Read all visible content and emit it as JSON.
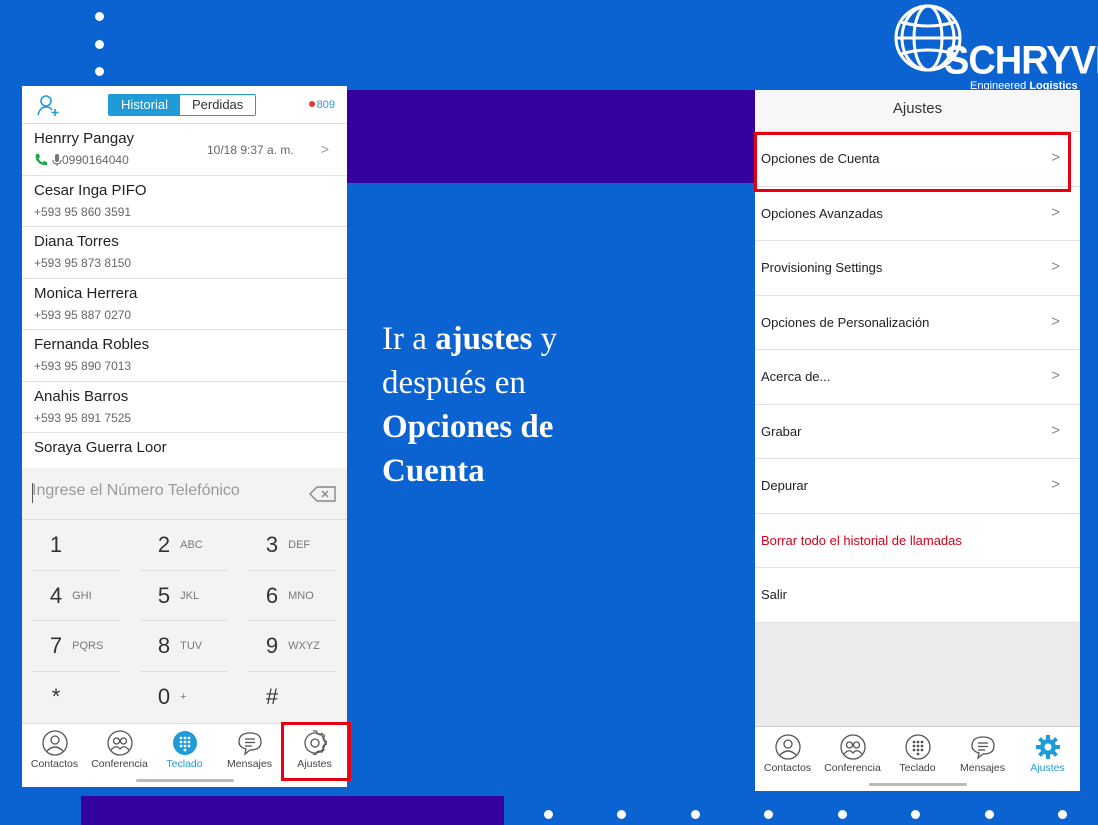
{
  "logo": {
    "brand": "SCHRYVER",
    "tagline_prefix": "Engineered ",
    "tagline_bold": "Logistics"
  },
  "instruction": {
    "part1": "Ir a ",
    "bold1": "ajustes",
    "part2": " y después en ",
    "bold2": "Opciones de Cuenta"
  },
  "left_phone": {
    "segment": {
      "active": "Historial",
      "inactive": "Perdidas"
    },
    "extension": "809",
    "calls": [
      {
        "name": "Henrry Pangay",
        "number": "0990164040",
        "time": "10/18 9:37 a. m."
      },
      {
        "name": "Cesar Inga PIFO",
        "number": "+593 95 860 3591"
      },
      {
        "name": "Diana Torres",
        "number": "+593 95 873 8150"
      },
      {
        "name": "Monica Herrera",
        "number": "+593 95 887 0270"
      },
      {
        "name": "Fernanda Robles",
        "number": "+593 95 890 7013"
      },
      {
        "name": "Anahis Barros",
        "number": "+593 95 891 7525"
      },
      {
        "name": "Soraya Guerra Loor"
      }
    ],
    "dial_placeholder": "Ingrese el Número Telefónico",
    "keys": [
      {
        "digit": "1",
        "letters": ""
      },
      {
        "digit": "2",
        "letters": "ABC"
      },
      {
        "digit": "3",
        "letters": "DEF"
      },
      {
        "digit": "4",
        "letters": "GHI"
      },
      {
        "digit": "5",
        "letters": "JKL"
      },
      {
        "digit": "6",
        "letters": "MNO"
      },
      {
        "digit": "7",
        "letters": "PQRS"
      },
      {
        "digit": "8",
        "letters": "TUV"
      },
      {
        "digit": "9",
        "letters": "WXYZ"
      },
      {
        "digit": "*",
        "letters": ""
      },
      {
        "digit": "0",
        "letters": "+"
      },
      {
        "digit": "#",
        "letters": ""
      }
    ],
    "tabs": [
      "Contactos",
      "Conferencia",
      "Teclado",
      "Mensajes",
      "Ajustes"
    ],
    "active_tab": "Teclado"
  },
  "right_phone": {
    "title": "Ajustes",
    "items": [
      "Opciones de Cuenta",
      "Opciones Avanzadas",
      "Provisioning Settings",
      "Opciones de Personalización",
      "Acerca de...",
      "Grabar",
      "Depurar",
      "Borrar todo el historial de llamadas",
      "Salir"
    ],
    "tabs": [
      "Contactos",
      "Conferencia",
      "Teclado",
      "Mensajes",
      "Ajustes"
    ],
    "active_tab": "Ajustes"
  },
  "colors": {
    "background": "#0a63d0",
    "band": "#34009f",
    "accent": "#1f9bd7",
    "highlight": "#e60012",
    "danger": "#d0021b"
  }
}
